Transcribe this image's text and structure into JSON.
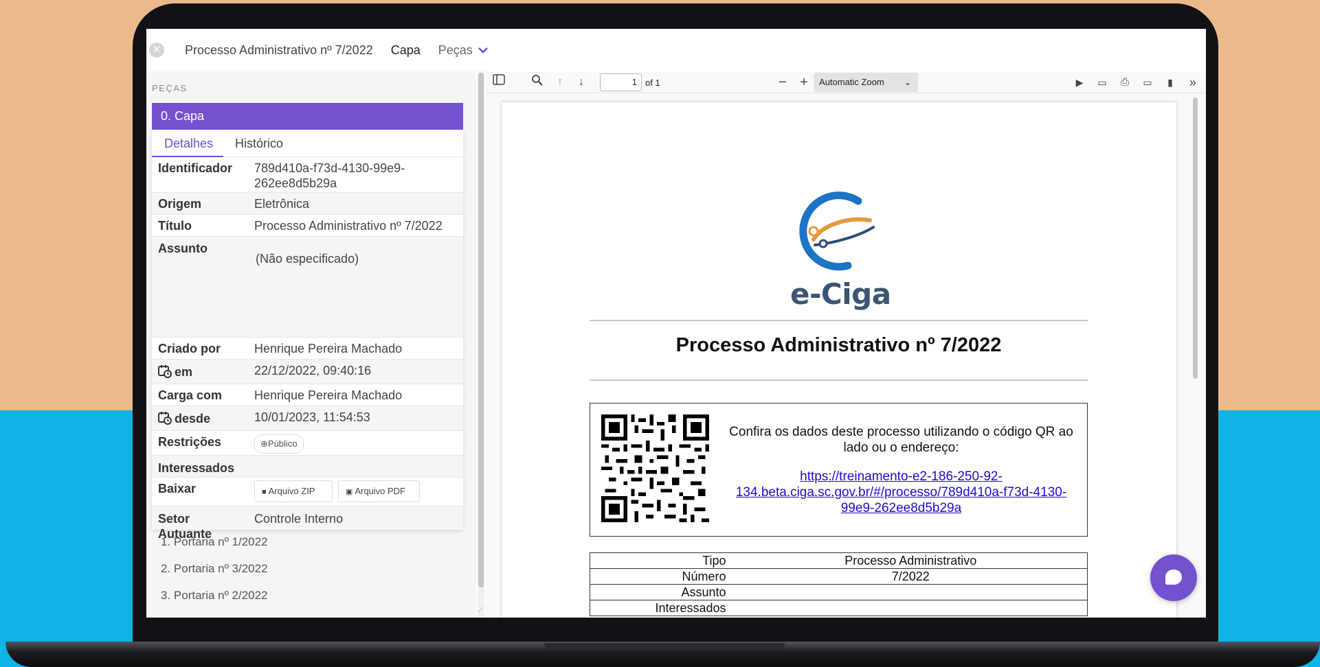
{
  "app": {
    "process_title": "Processo Administrativo nº 7/2022",
    "menu_capa": "Capa",
    "menu_pecas": "Peças"
  },
  "sidebar": {
    "section_label": "PEÇAS",
    "selected_item": "0. Capa",
    "tabs": [
      "Detalhes",
      "Histórico"
    ],
    "details": {
      "identificador_label": "Identificador",
      "identificador_value_1": "789d410a-f73d-4130-99e9-",
      "identificador_value_2": "262ee8d5b29a",
      "origem_label": "Origem",
      "origem_value": "Eletrônica",
      "titulo_label": "Título",
      "titulo_value": "Processo Administrativo nº 7/2022",
      "assunto_label": "Assunto",
      "assunto_value": "(Não especificado)",
      "criado_por_label": "Criado por",
      "criado_por_value": "Henrique Pereira Machado",
      "em_label": "em",
      "em_value": "22/12/2022, 09:40:16",
      "carga_label": "Carga com",
      "carga_value": "Henrique Pereira Machado",
      "desde_label": "desde",
      "desde_value": "10/01/2023, 11:54:53",
      "restricoes_label": "Restrições",
      "restricoes_value": "Público",
      "interessados_label": "Interessados",
      "baixar_label": "Baixar",
      "zip_button": "Arquivo ZIP",
      "pdf_button": "Arquivo PDF",
      "setor_label_1": "Setor",
      "setor_label_2": "Autuante",
      "setor_value": "Controle Interno"
    },
    "items": [
      "1. Portaria nº 1/2022",
      "2. Portaria nº 3/2022",
      "3. Portaria nº 2/2022"
    ]
  },
  "pdf": {
    "page_number": "1",
    "page_count": "of 1",
    "zoom": "Automatic Zoom",
    "logo_text": "e-Ciga",
    "doc_title": "Processo Administrativo nº 7/2022",
    "qr_text": "Confira os dados deste processo utilizando o código QR ao lado ou o endereço:",
    "qr_link_1": "https://treinamento-e2-186-250-92-",
    "qr_link_2": "134.beta.ciga.sc.gov.br/#/processo/789d410a-f73d-4130-",
    "qr_link_3": "99e9-262ee8d5b29a",
    "table": [
      {
        "key": "Tipo",
        "value": "Processo Administrativo"
      },
      {
        "key": "Número",
        "value": "7/2022"
      },
      {
        "key": "Assunto",
        "value": ""
      },
      {
        "key": "Interessados",
        "value": ""
      }
    ]
  },
  "colors": {
    "accent": "#7352cf",
    "background_top": "#ecb98a",
    "background_bottom": "#0fb3e6"
  }
}
